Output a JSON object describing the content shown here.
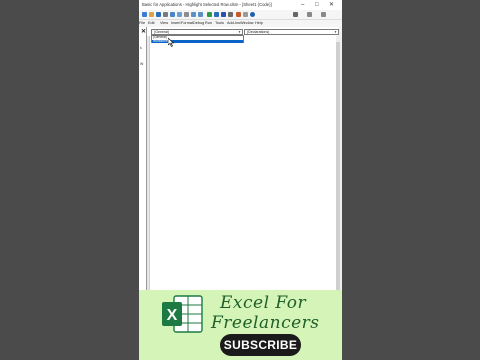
{
  "window": {
    "title": "Basic for Applications - Highlight Selected Row.xlsm - [Sheet1 (Code)]",
    "controls": [
      "–",
      "□",
      "✕"
    ]
  },
  "menu": [
    "File",
    "Edit",
    "View",
    "Insert",
    "Format",
    "Debug",
    "Run",
    "Tools",
    "Add-Ins",
    "Window",
    "Help"
  ],
  "code_window": {
    "object_dropdown": "(General)",
    "procedure_dropdown": "(Declarations)",
    "object_list": [
      "(General)",
      "Worksheet"
    ],
    "selected_index": 1
  },
  "left_pane": {
    "close_glyph": "✕",
    "labels": [
      "k",
      "W"
    ]
  },
  "branding": {
    "line1": "Excel For",
    "line2": "Freelancers",
    "subscribe_label": "SUBSCRIBE",
    "logo_letter": "X"
  },
  "colors": {
    "banner": "#d5f5b8",
    "selection": "#0a64c8",
    "brand_text": "#1f5f2a",
    "excel_green": "#1d7a43"
  }
}
